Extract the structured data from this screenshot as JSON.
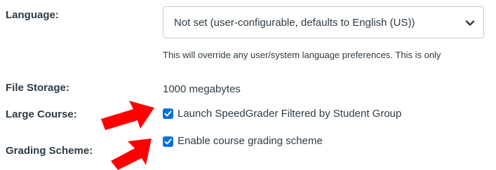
{
  "language": {
    "label": "Language:",
    "selected": "Not set (user-configurable, defaults to English (US))",
    "hint": "This will override any user/system language preferences. This is only"
  },
  "file_storage": {
    "label": "File Storage:",
    "value": "1000 megabytes"
  },
  "large_course": {
    "label": "Large Course:",
    "checkbox_label": "Launch SpeedGrader Filtered by Student Group",
    "checked": true
  },
  "grading_scheme": {
    "label": "Grading Scheme:",
    "checkbox_label": "Enable course grading scheme",
    "checked": true
  },
  "colors": {
    "checkbox_accent": "#0770d9",
    "annotation_arrow": "#ff0000",
    "text": "#2d3b45"
  }
}
